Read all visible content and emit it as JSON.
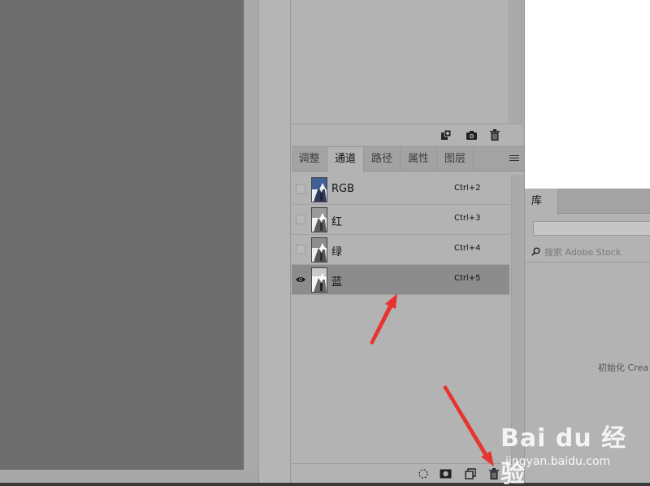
{
  "channels_panel": {
    "tabs": [
      {
        "label": "调整"
      },
      {
        "label": "通道"
      },
      {
        "label": "路径"
      },
      {
        "label": "属性"
      },
      {
        "label": "图层"
      }
    ],
    "active_tab": "通道",
    "channels": [
      {
        "name": "RGB",
        "shortcut": "Ctrl+2",
        "visible": false,
        "selected": false
      },
      {
        "name": "红",
        "shortcut": "Ctrl+3",
        "visible": false,
        "selected": false
      },
      {
        "name": "绿",
        "shortcut": "Ctrl+4",
        "visible": false,
        "selected": false
      },
      {
        "name": "蓝",
        "shortcut": "Ctrl+5",
        "visible": true,
        "selected": true
      }
    ],
    "footer_icons": [
      "load-selection-icon",
      "save-selection-icon",
      "new-channel-icon",
      "delete-channel-icon"
    ]
  },
  "history_panel": {
    "footer_icons": [
      "new-document-icon",
      "snapshot-camera-icon",
      "delete-icon"
    ]
  },
  "library_panel": {
    "tab_label": "库",
    "search_placeholder": "搜索 Adobe Stock",
    "status_text": "初始化 Crea"
  },
  "watermark": {
    "main": "Bai du 经验",
    "sub": "jingyan.baidu.com"
  },
  "colors": {
    "canvas": "#6e6e6e",
    "panel": "#b3b3b3",
    "selected_row": "#8c8c8c",
    "annotation_arrow": "#e8332e"
  }
}
